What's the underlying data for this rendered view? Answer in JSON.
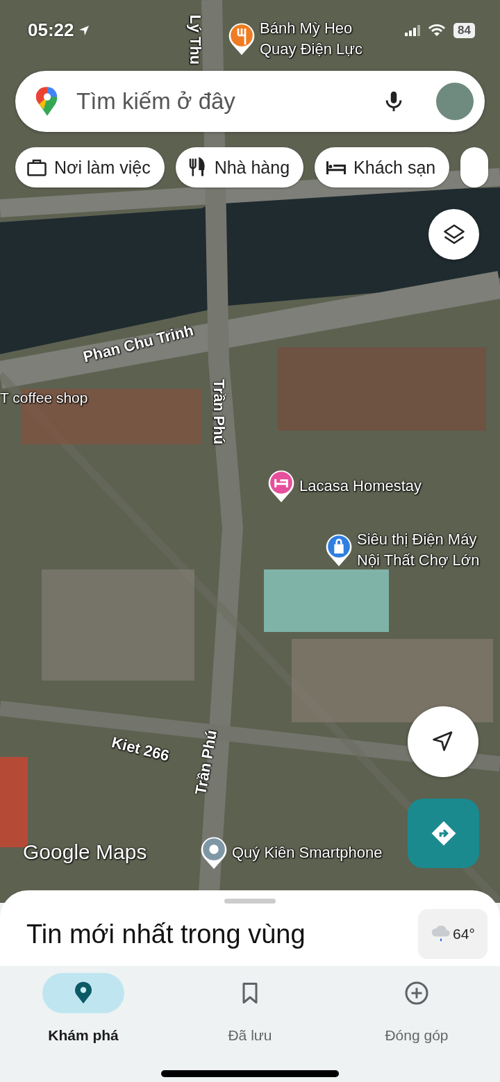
{
  "status_bar": {
    "time": "05:22",
    "battery": "84"
  },
  "search": {
    "placeholder": "Tìm kiếm ở đây"
  },
  "chips": [
    {
      "kind": "work",
      "label": "Nơi làm việc"
    },
    {
      "kind": "restaurant",
      "label": "Nhà hàng"
    },
    {
      "kind": "hotel",
      "label": "Khách sạn"
    }
  ],
  "map_labels": [
    {
      "kind": "food",
      "text": "Bánh Mỳ Heo Quay Điện Lực"
    },
    {
      "kind": "street",
      "text": "Lý Thu"
    },
    {
      "kind": "street",
      "text": "Phan Chu Trinh"
    },
    {
      "kind": "street",
      "text": "Trần Phú"
    },
    {
      "kind": "place",
      "text": "T coffee shop"
    },
    {
      "kind": "hotel",
      "text": "Lacasa Homestay"
    },
    {
      "kind": "shop",
      "text": "Siêu thị Điện Máy Nội Thất Chợ Lớn"
    },
    {
      "kind": "street",
      "text": "Kiet 266"
    },
    {
      "kind": "street",
      "text": "Trần Phú"
    },
    {
      "kind": "pin",
      "text": "Quý Kiên Smartphone"
    }
  ],
  "map_logo": "Google Maps",
  "sheet": {
    "title": "Tin mới nhất trong vùng",
    "weather": "64°"
  },
  "nav": [
    {
      "kind": "explore",
      "label": "Khám phá",
      "selected": true
    },
    {
      "kind": "saved",
      "label": "Đã lưu",
      "selected": false
    },
    {
      "kind": "contribute",
      "label": "Đóng góp",
      "selected": false
    }
  ]
}
